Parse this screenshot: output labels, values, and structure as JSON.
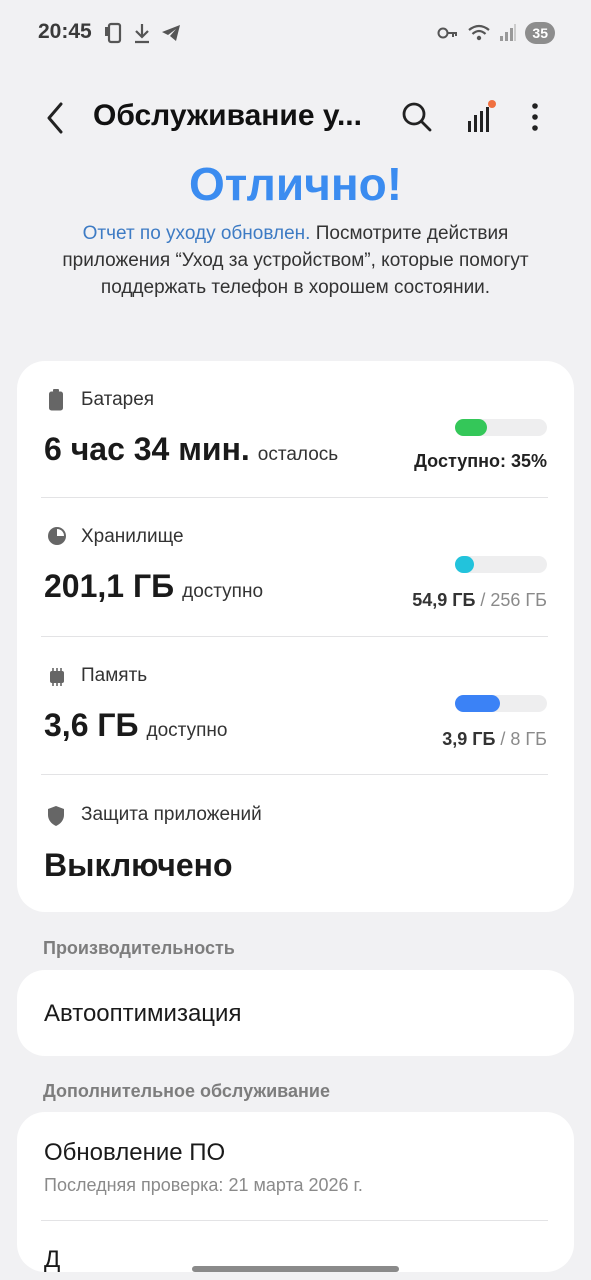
{
  "status_bar": {
    "time": "20:45",
    "battery_level": "35",
    "icons_left": [
      "phone-icon",
      "download-icon",
      "telegram-icon"
    ],
    "icons_right": [
      "key-icon",
      "wifi-icon",
      "signal-icon"
    ]
  },
  "app_bar": {
    "title": "Обслуживание у...",
    "icons": [
      "back-arrow-icon",
      "search-icon",
      "signal-chart-icon",
      "more-vert-icon"
    ]
  },
  "status_heading": "Отлично!",
  "report": {
    "link_text": "Отчет по уходу обновлен.",
    "body_text": " Посмотрите действия приложения “Уход за устройством”, которые помогут поддержать телефон в хорошем состоянии."
  },
  "battery": {
    "label": "Батарея",
    "value": "6 час 34 мин.",
    "suffix": "осталось",
    "caption": "Доступно: 35%",
    "fill_fraction": 0.35,
    "color": "#34c759"
  },
  "storage": {
    "label": "Хранилище",
    "value": "201,1 ГБ",
    "suffix": "доступно",
    "used": "54,9 ГБ",
    "total": " / 256 ГБ",
    "fill_fraction": 0.21,
    "color": "#22c3dc"
  },
  "memory": {
    "label": "Память",
    "value": "3,6 ГБ",
    "suffix": "доступно",
    "used": "3,9 ГБ",
    "total": " / 8 ГБ",
    "fill_fraction": 0.49,
    "color": "#3b82f6"
  },
  "app_protection": {
    "label": "Защита приложений",
    "value": "Выключено"
  },
  "performance": {
    "header": "Производительность",
    "item": "Автооптимизация"
  },
  "extra": {
    "header": "Дополнительное обслуживание",
    "update_title": "Обновление ПО",
    "update_subtitle": "Последняя проверка: 21 марта 2026 г.",
    "next_item_partial": "Д"
  },
  "colors": {
    "accent": "#3b8cf0",
    "link": "#3d7bc4",
    "notification_dot": "#f07040"
  }
}
